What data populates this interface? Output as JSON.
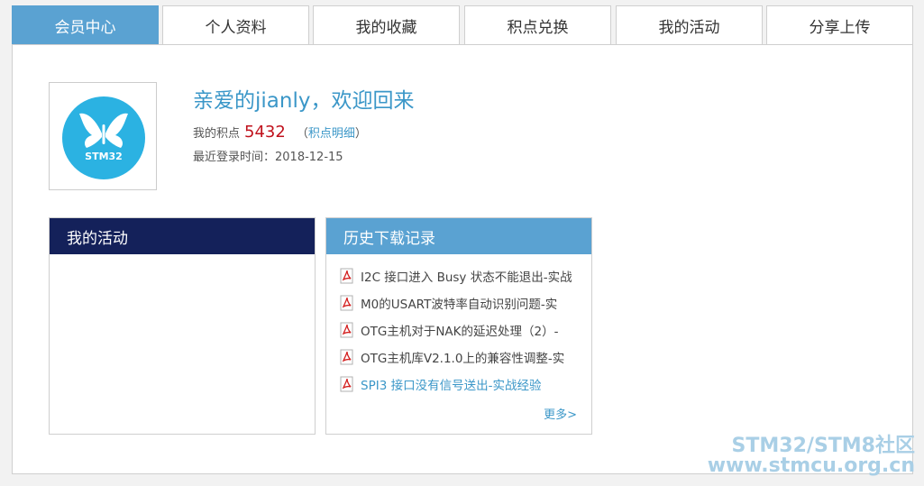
{
  "tabs": [
    {
      "label": "会员中心",
      "active": true
    },
    {
      "label": "个人资料",
      "active": false
    },
    {
      "label": "我的收藏",
      "active": false
    },
    {
      "label": "积点兑换",
      "active": false
    },
    {
      "label": "我的活动",
      "active": false
    },
    {
      "label": "分享上传",
      "active": false
    }
  ],
  "profile": {
    "avatar_icon": "butterfly-logo-icon",
    "logo_text": "STM32",
    "welcome": "亲爱的jianly，欢迎回来",
    "points_label": "我的积点",
    "points_value": "5432",
    "paren_open": "（",
    "points_detail_link": "积点明细",
    "paren_close": "）",
    "last_login_label": "最近登录时间：",
    "last_login_date": "2018-12-15"
  },
  "activity_box": {
    "title": "我的活动"
  },
  "history_box": {
    "title": "历史下载记录",
    "items": [
      {
        "label": "I2C 接口进入 Busy 状态不能退出-实战"
      },
      {
        "label": "M0的USART波特率自动识别问题-实"
      },
      {
        "label": "OTG主机对于NAK的延迟处理（2）-"
      },
      {
        "label": "OTG主机库V2.1.0上的兼容性调整-实"
      },
      {
        "label": "SPI3 接口没有信号送出-实战经验"
      }
    ],
    "more_link": "更多>"
  },
  "watermark": {
    "line1": "STM32/STM8社区",
    "line2": "www.stmcu.org.cn"
  },
  "colors": {
    "accent": "#5aa2d2",
    "dark_header": "#14215a",
    "points": "#c0111c",
    "link": "#3b97c8"
  }
}
